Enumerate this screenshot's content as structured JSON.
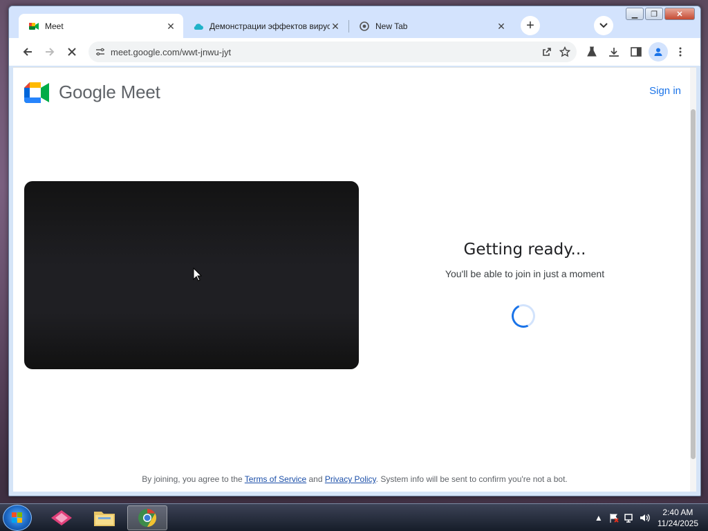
{
  "browser": {
    "tabs": [
      {
        "title": "Meet",
        "active": true
      },
      {
        "title": "Демонстрации эффектов вирус",
        "active": false
      },
      {
        "title": "New Tab",
        "active": false
      }
    ],
    "url": "meet.google.com/wwt-jnwu-jyt"
  },
  "meet": {
    "brand": "Google Meet",
    "sign_in": "Sign in",
    "status_title": "Getting ready...",
    "status_subtitle": "You'll be able to join in just a moment",
    "footer": {
      "prefix": "By joining, you agree to the ",
      "terms": "Terms of Service",
      "and": " and ",
      "privacy": "Privacy Policy",
      "suffix": ". System info will be sent to confirm you're not a bot."
    }
  },
  "taskbar": {
    "time": "2:40 AM",
    "date": "11/24/2025"
  },
  "colors": {
    "accent": "#1a73e8",
    "tab_strip": "#d3e3fd"
  }
}
